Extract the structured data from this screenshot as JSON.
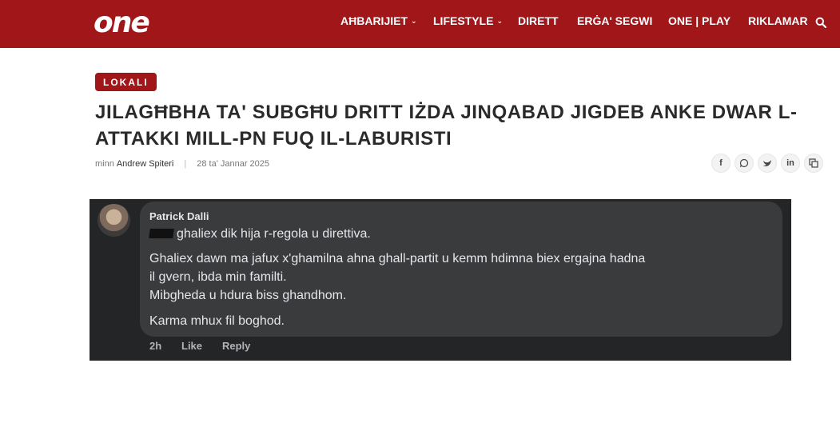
{
  "header": {
    "logo": "one",
    "nav": [
      {
        "label": "AĦBARIJIET",
        "has_dropdown": true
      },
      {
        "label": "LIFESTYLE",
        "has_dropdown": true
      },
      {
        "label": "DIRETT",
        "has_dropdown": false
      },
      {
        "label": "ERĠA' SEGWI",
        "has_dropdown": false
      },
      {
        "label": "ONE | PLAY",
        "has_dropdown": false
      },
      {
        "label": "RIKLAMAR",
        "has_dropdown": false
      }
    ],
    "search_icon": "search-icon",
    "bg_color": "#a01619"
  },
  "article": {
    "category": "LOKALI",
    "title": "JILAGĦBHA TA' SUBGĦU DRITT IŻDA JINQABAD JIGDEB ANKE DWAR L-ATTAKKI MILL-PN FUQ IL-LABURISTI",
    "byline_prefix": "minn",
    "author": "Andrew Spiteri",
    "separator": "|",
    "date": "28 ta' Jannar 2025",
    "share_icons": [
      "facebook-icon",
      "whatsapp-icon",
      "twitter-icon",
      "linkedin-icon",
      "copy-icon"
    ]
  },
  "comment": {
    "name": "Patrick Dalli",
    "lines": [
      "ghaliex dik hija r-regola u direttiva.",
      "Ghaliex dawn ma jafux x'ghamilna ahna ghall-partit u kemm hdimna biex ergajna hadna",
      "il gvern, ibda min familti.",
      "Mibgheda u hdura biss ghandhom.",
      "Karma mhux fil boghod."
    ],
    "time": "2h",
    "like": "Like",
    "reply": "Reply"
  }
}
